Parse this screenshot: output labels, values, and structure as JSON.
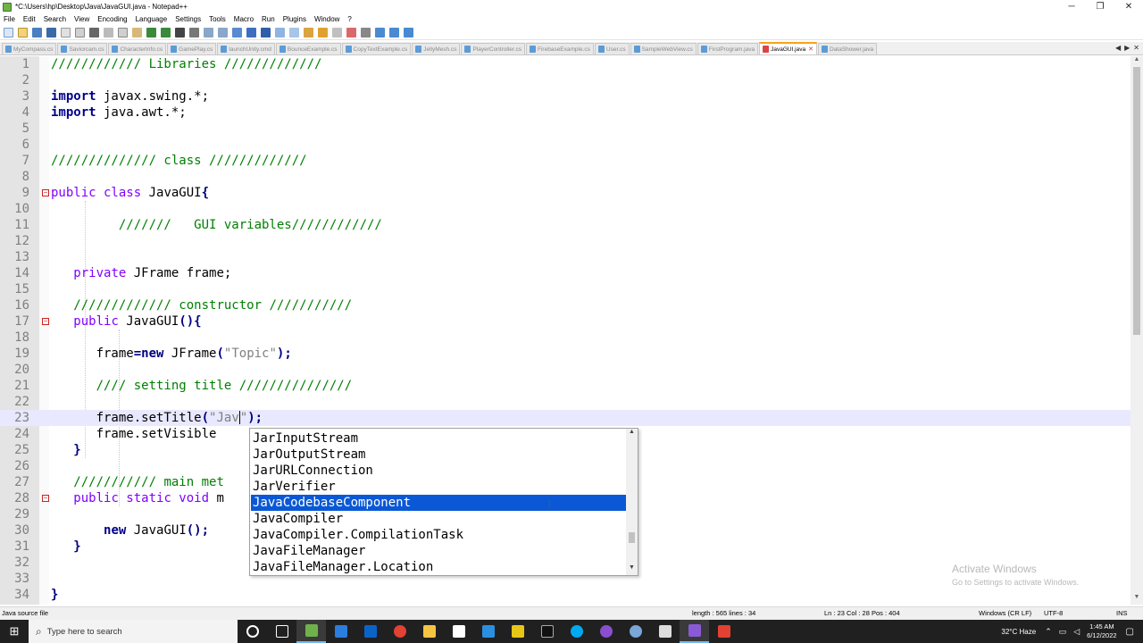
{
  "window": {
    "title": "*C:\\Users\\hp\\Desktop\\Java\\JavaGUI.java - Notepad++",
    "minimize": "─",
    "maximize": "❐",
    "close": "✕"
  },
  "menu": [
    "File",
    "Edit",
    "Search",
    "View",
    "Encoding",
    "Language",
    "Settings",
    "Tools",
    "Macro",
    "Run",
    "Plugins",
    "Window",
    "?"
  ],
  "tabs": [
    {
      "label": "MyCompass.cs",
      "active": false
    },
    {
      "label": "Saviorcam.cs",
      "active": false
    },
    {
      "label": "CharacterInfo.cs",
      "active": false
    },
    {
      "label": "GamePlay.cs",
      "active": false
    },
    {
      "label": "launchUnity.cmd",
      "active": false
    },
    {
      "label": "BounceExample.cs",
      "active": false
    },
    {
      "label": "CopyTextExample.cs",
      "active": false
    },
    {
      "label": "JellyMesh.cs",
      "active": false
    },
    {
      "label": "PlayerController.cs",
      "active": false
    },
    {
      "label": "FirebaseExample.cs",
      "active": false
    },
    {
      "label": "User.cs",
      "active": false
    },
    {
      "label": "SampleWebView.cs",
      "active": false
    },
    {
      "label": "FirstProgram.java",
      "active": false
    },
    {
      "label": "JavaGUI.java",
      "active": true
    },
    {
      "label": "DataShower.java",
      "active": false
    }
  ],
  "tab_arrows": [
    "◀",
    "▶",
    "✕"
  ],
  "editor": {
    "line_numbers": [
      "1",
      "2",
      "3",
      "4",
      "5",
      "6",
      "7",
      "8",
      "9",
      "10",
      "11",
      "12",
      "13",
      "14",
      "15",
      "16",
      "17",
      "18",
      "19",
      "20",
      "21",
      "22",
      "23",
      "24",
      "25",
      "26",
      "27",
      "28",
      "29",
      "30",
      "31",
      "32",
      "33",
      "34"
    ],
    "lines": {
      "l1": "//////////// Libraries /////////////",
      "l3_kw": "import",
      "l3_rest": " javax.swing.*;",
      "l4_kw": "import",
      "l4_rest": " java.awt.*;",
      "l7": "////////////// class /////////////",
      "l9_kw": "public class",
      "l9_rest": " JavaGUI",
      "l9_brace": "{",
      "l11": "///////   GUI variables////////////",
      "l14_kw": "private",
      "l14_rest": " JFrame frame;",
      "l16": "///////////// constructor ///////////",
      "l17_kw": "public",
      "l17_rest": " JavaGUI",
      "l17_paren": "(){",
      "l19_a": "frame",
      "l19_op": "=new",
      "l19_b": " JFrame",
      "l19_p1": "(",
      "l19_str": "\"Topic\"",
      "l19_p2": ");",
      "l21": "//// setting title ///////////////",
      "l23_a": "frame.setTitle",
      "l23_p1": "(",
      "l23_str": "\"Jav",
      "l23_str2": "\"",
      "l23_p2": ");",
      "l24_a": "frame.setVisible",
      "l25": "}",
      "l27": "/////////// main met",
      "l28_kw": "public static void",
      "l28_rest": " m",
      "l30_kw": "new",
      "l30_rest": " JavaGUI",
      "l30_p": "();",
      "l31": "}",
      "l34": "}"
    }
  },
  "autocomplete": {
    "items": [
      "JarInputStream",
      "JarOutputStream",
      "JarURLConnection",
      "JarVerifier",
      "JavaCodebaseComponent",
      "JavaCompiler",
      "JavaCompiler.CompilationTask",
      "JavaFileManager",
      "JavaFileManager.Location"
    ],
    "selected_index": 4,
    "scroll_up": "▲",
    "scroll_down": "▼"
  },
  "activation": {
    "line1": "Activate Windows",
    "line2": "Go to Settings to activate Windows."
  },
  "status": {
    "file_type": "Java source file",
    "length": "length : 565    lines : 34",
    "position": "Ln : 23    Col : 28    Pos : 404",
    "eol": "Windows (CR LF)",
    "encoding": "UTF-8",
    "mode": "INS"
  },
  "taskbar": {
    "search_placeholder": "Type here to search",
    "weather": "32°C  Haze",
    "time": "1:45 AM",
    "date": "6/12/2022"
  },
  "colors": {
    "accent_tab": "#f7a21a",
    "selection": "#0a58d6",
    "comment": "#008000",
    "keyword": "#00008b",
    "type_keyword": "#8000ff",
    "string": "#808080"
  }
}
